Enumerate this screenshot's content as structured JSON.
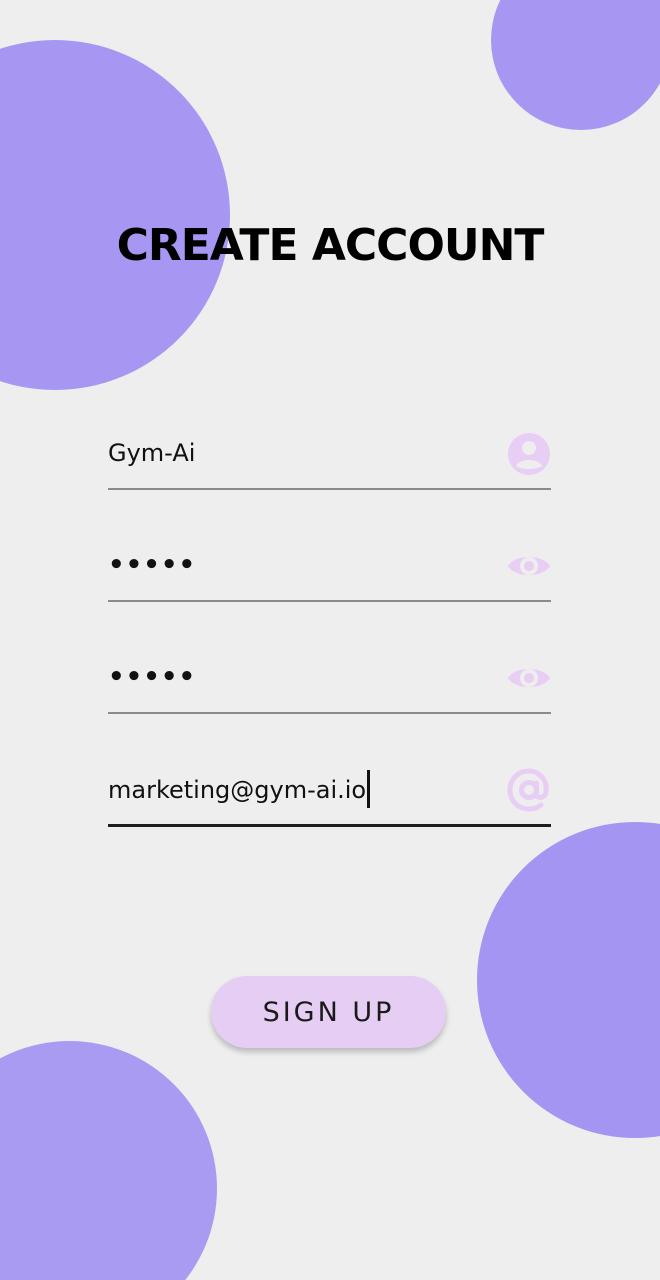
{
  "title": "CREATE ACCOUNT",
  "fields": {
    "username": {
      "value": "Gym-Ai",
      "icon": "account-circle-icon"
    },
    "password": {
      "value": "•••••",
      "icon": "eye-icon"
    },
    "confirm_password": {
      "value": "•••••",
      "icon": "eye-icon"
    },
    "email": {
      "value": "marketing@gym-ai.io",
      "icon": "at-sign-icon",
      "focused": true
    }
  },
  "signup_button": {
    "label": "SIGN UP"
  },
  "colors": {
    "background": "#eeeeee",
    "circle": "#a897f2",
    "icon": "#e8cdf5",
    "button": "#e6cdf3",
    "text": "#000000"
  }
}
